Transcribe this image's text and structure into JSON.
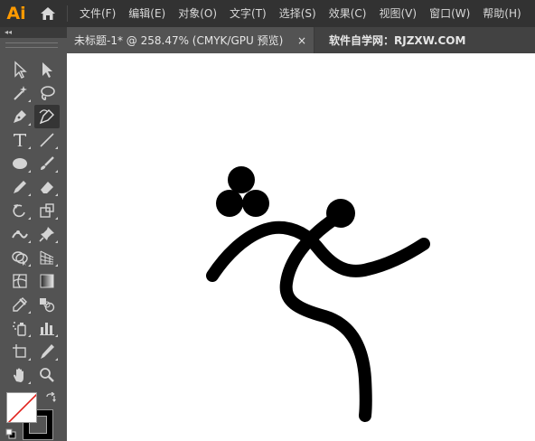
{
  "app": {
    "logo_text": "Ai",
    "brand_color": "#FF9A00"
  },
  "menu": {
    "items": [
      {
        "label": "文件(F)"
      },
      {
        "label": "编辑(E)"
      },
      {
        "label": "对象(O)"
      },
      {
        "label": "文字(T)"
      },
      {
        "label": "选择(S)"
      },
      {
        "label": "效果(C)"
      },
      {
        "label": "视图(V)"
      },
      {
        "label": "窗口(W)"
      },
      {
        "label": "帮助(H)"
      }
    ]
  },
  "tabs": {
    "document_title": "未标题-1* @ 258.47% (CMYK/GPU 预览)",
    "close_symbol": "×",
    "site_label": "软件自学网：RJZXW.COM"
  },
  "panel": {
    "collapse_symbol": "◂◂"
  },
  "tools": [
    "selection-tool",
    "direct-selection-tool",
    "magic-wand-tool",
    "lasso-tool",
    "pen-tool",
    "curvature-tool",
    "type-tool",
    "line-segment-tool",
    "ellipse-tool",
    "paintbrush-tool",
    "shaper-tool",
    "eraser-tool",
    "rotate-tool",
    "scale-tool",
    "width-tool",
    "puppet-warp-tool",
    "shape-builder-tool",
    "perspective-grid-tool",
    "mesh-tool",
    "gradient-tool",
    "eyedropper-tool",
    "blend-tool",
    "symbol-sprayer-tool",
    "column-graph-tool",
    "artboard-tool",
    "slice-tool",
    "hand-tool",
    "zoom-tool"
  ],
  "colors": {
    "fill": "#ffffff",
    "stroke": "#000000",
    "none_indicator": "#e0201b",
    "artwork": "#000000"
  }
}
